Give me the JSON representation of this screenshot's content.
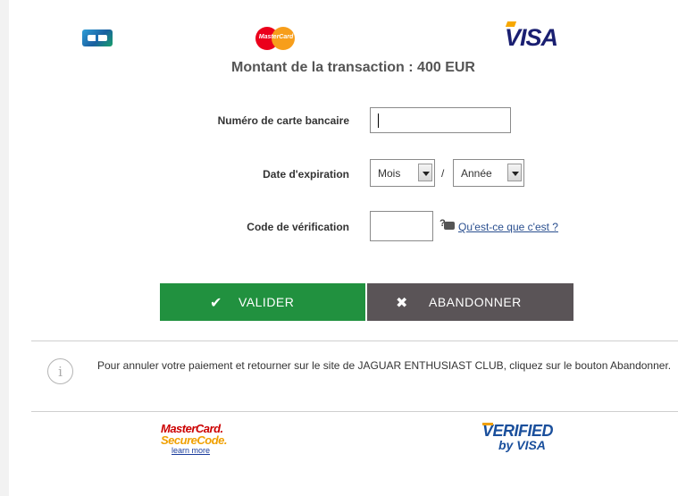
{
  "header": {
    "card_logos": [
      "cb-logo",
      "mastercard-logo",
      "visa-logo"
    ],
    "mastercard_text": "MasterCard",
    "visa_text": "VISA",
    "amount_text": "Montant de la transaction : 400 EUR"
  },
  "form": {
    "card_number_label": "Numéro de carte bancaire",
    "card_number_value": "",
    "expiry_label": "Date d'expiration",
    "month_value": "Mois",
    "separator": "/",
    "year_value": "Année",
    "cvv_label": "Code de vérification",
    "cvv_value": "",
    "help_link": "Qu'est-ce que c'est ?"
  },
  "buttons": {
    "validate_label": "VALIDER",
    "validate_icon": "check-icon",
    "cancel_label": "ABANDONNER",
    "cancel_icon": "close-icon"
  },
  "info": {
    "icon": "info-icon",
    "text": "Pour annuler votre paiement et retourner sur le site de JAGUAR ENTHUSIAST CLUB, cliquez sur le bouton Abandonner."
  },
  "footer": {
    "securecode_line1": "MasterCard.",
    "securecode_line2": "SecureCode.",
    "securecode_link": "learn more",
    "verified_line1": "VERIFIED",
    "verified_line2": "by VISA"
  },
  "colors": {
    "validate": "#21913f",
    "cancel": "#5a5457",
    "link": "#2a4f8f"
  }
}
